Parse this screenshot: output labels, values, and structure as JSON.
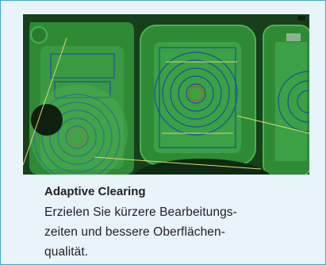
{
  "feature": {
    "title": "Adaptive Clearing",
    "description_lines": [
      "Erzielen Sie kürzere Bearbeitungs-",
      "zeiten und bessere Oberflächen-",
      "qualität."
    ]
  },
  "media": {
    "icon": "cnc-toolpath-image",
    "colors": {
      "part": "#2f8a36",
      "pocket": "#3aa144",
      "paths": "#1e4fa0",
      "highlight": "#e0d86a"
    }
  }
}
